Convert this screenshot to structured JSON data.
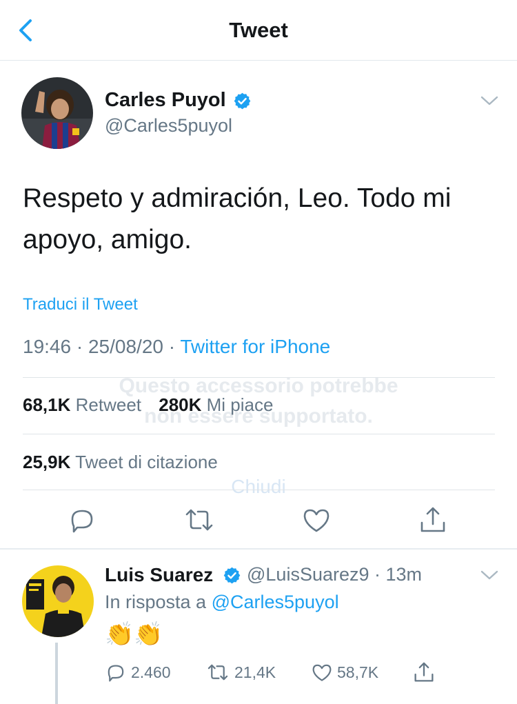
{
  "header": {
    "title": "Tweet"
  },
  "tweet": {
    "author_name": "Carles Puyol",
    "author_handle": "@Carles5puyol",
    "text": "Respeto y admiración, Leo. Todo mi apoyo, amigo.",
    "translate_label": "Traduci il Tweet",
    "time": "19:46",
    "date": "25/08/20",
    "separator": "·",
    "source": "Twitter for iPhone",
    "retweets_count": "68,1K",
    "retweets_label": "Retweet",
    "likes_count": "280K",
    "likes_label": "Mi piace",
    "quotes_count": "25,9K",
    "quotes_label": "Tweet di citazione"
  },
  "overlay": {
    "line1": "Questo accessorio potrebbe",
    "line2": "non essere supportato.",
    "close": "Chiudi"
  },
  "reply": {
    "author_name": "Luis Suarez",
    "author_handle": "@LuisSuarez9",
    "time_ago": "· 13m",
    "in_reply_prefix": "In risposta a",
    "in_reply_mention": "@Carles5puyol",
    "text": "👏👏",
    "replies_count": "2.460",
    "retweets_count": "21,4K",
    "likes_count": "58,7K"
  },
  "colors": {
    "accent": "#1da1f2",
    "muted": "#657786",
    "text": "#14171a",
    "divider": "#e1e8ed"
  },
  "icons": [
    "back-arrow-icon",
    "verified-badge-icon",
    "chevron-down-icon",
    "reply-icon",
    "retweet-icon",
    "like-heart-icon",
    "share-icon"
  ]
}
